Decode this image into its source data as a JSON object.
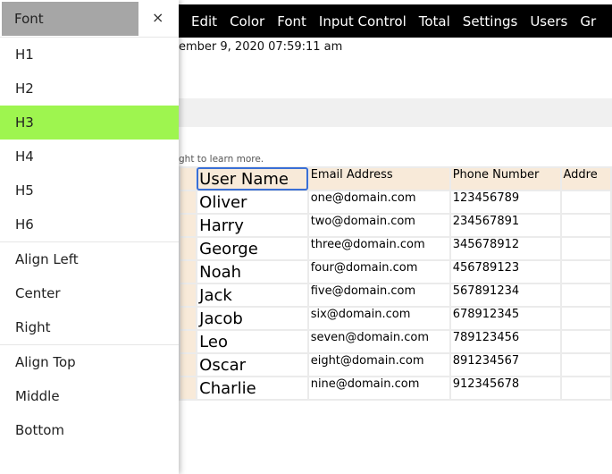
{
  "menubar": {
    "items": [
      "Edit",
      "Color",
      "Font",
      "Input Control",
      "Total",
      "Settings",
      "Users",
      "Gr"
    ]
  },
  "date_text": "ember 9, 2020 07:59:11 am",
  "hint_text": "ght to learn more.",
  "table": {
    "headers": [
      "User Name",
      "Email Address",
      "Phone Number",
      "Addre"
    ],
    "rows": [
      [
        "Oliver",
        "one@domain.com",
        "123456789"
      ],
      [
        "Harry",
        "two@domain.com",
        "234567891"
      ],
      [
        "George",
        "three@domain.com",
        "345678912"
      ],
      [
        "Noah",
        "four@domain.com",
        "456789123"
      ],
      [
        "Jack",
        "five@domain.com",
        "567891234"
      ],
      [
        "Jacob",
        "six@domain.com",
        "678912345"
      ],
      [
        "Leo",
        "seven@domain.com",
        "789123456"
      ],
      [
        "Oscar",
        "eight@domain.com",
        "891234567"
      ],
      [
        "Charlie",
        "nine@domain.com",
        "912345678"
      ]
    ]
  },
  "panel": {
    "title": "Font",
    "close": "×",
    "groups": [
      [
        "H1",
        "H2",
        "H3",
        "H4",
        "H5",
        "H6"
      ],
      [
        "Align Left",
        "Center",
        "Right"
      ],
      [
        "Align Top",
        "Middle",
        "Bottom"
      ]
    ],
    "active": "H3",
    "active_color": "#9ef54f"
  }
}
